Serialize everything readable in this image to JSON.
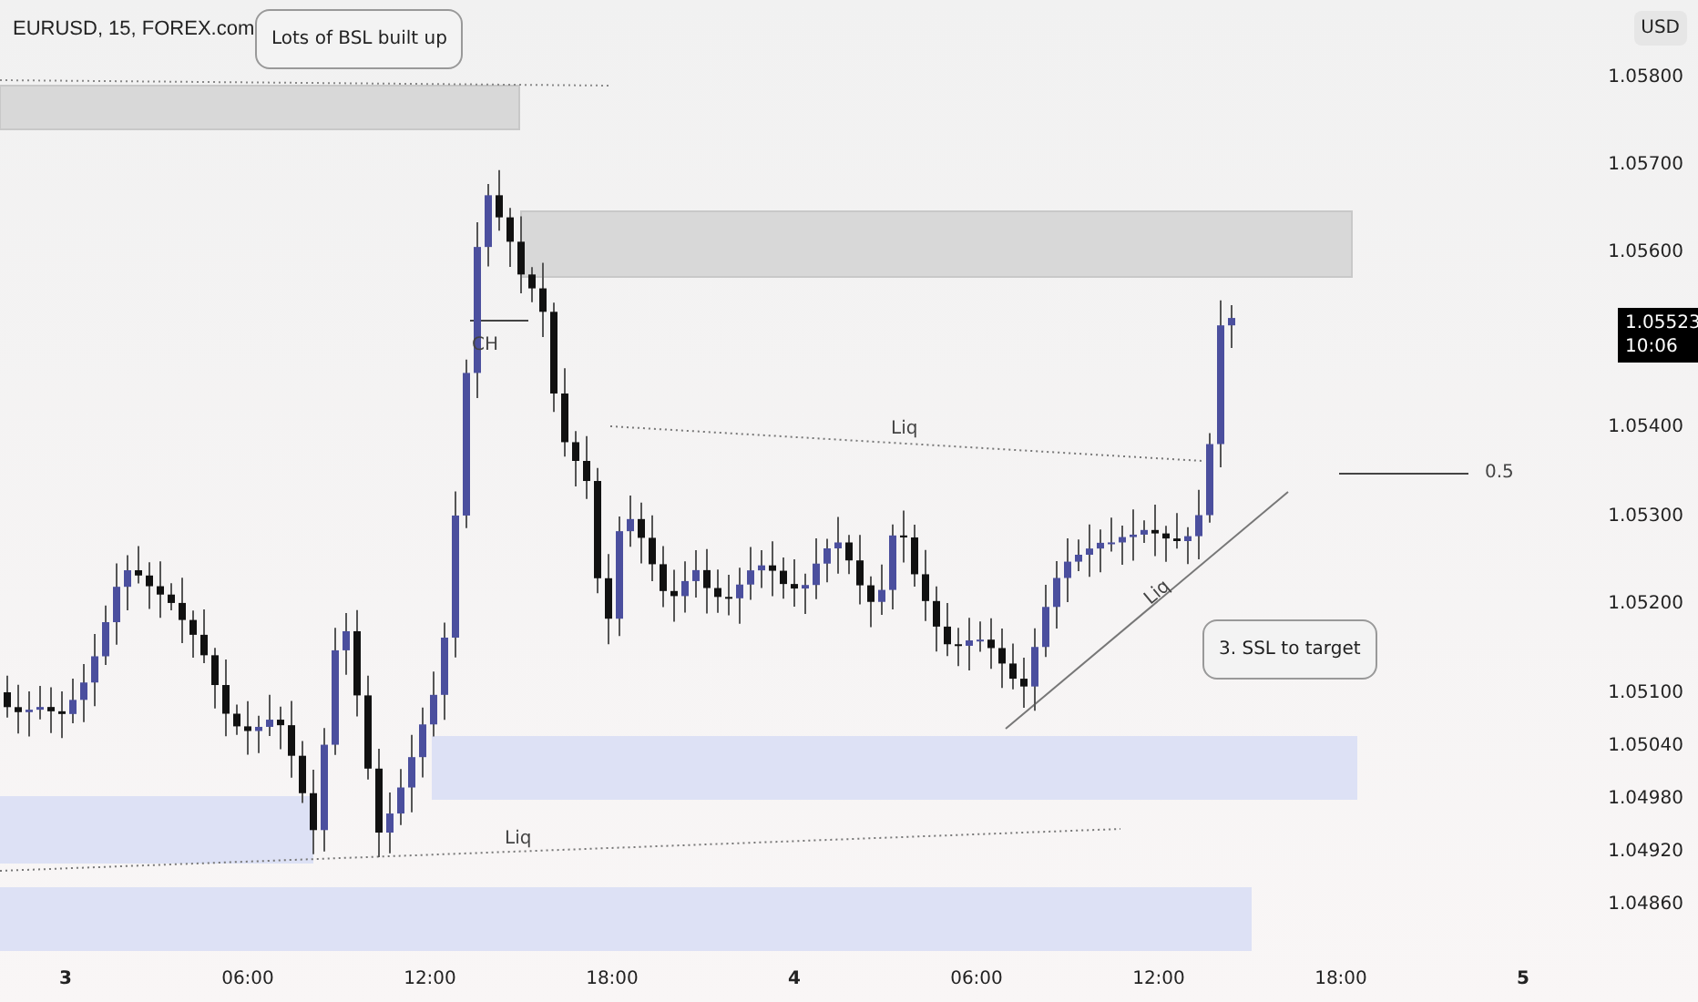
{
  "legend": {
    "title": "EURUSD, 15, FOREX.com"
  },
  "currency": "USD",
  "price_axis": [
    "1.05800",
    "1.05700",
    "1.05600",
    "1.05400",
    "1.05300",
    "1.05200",
    "1.05100",
    "1.05040",
    "1.04980",
    "1.04920",
    "1.04860"
  ],
  "last_price": {
    "price": "1.05523",
    "countdown": "10:06"
  },
  "time_axis": [
    {
      "label": "3",
      "bold": true
    },
    {
      "label": "06:00",
      "bold": false
    },
    {
      "label": "12:00",
      "bold": false
    },
    {
      "label": "18:00",
      "bold": false
    },
    {
      "label": "4",
      "bold": true
    },
    {
      "label": "06:00",
      "bold": false
    },
    {
      "label": "12:00",
      "bold": false
    },
    {
      "label": "18:00",
      "bold": false
    },
    {
      "label": "5",
      "bold": true
    }
  ],
  "annotations": [
    {
      "kind": "callout",
      "text": "Lots of BSL built up"
    },
    {
      "kind": "label",
      "text": "CH"
    },
    {
      "kind": "label",
      "text": "Liq"
    },
    {
      "kind": "label",
      "text": "Liq"
    },
    {
      "kind": "slanted",
      "text": "Liq"
    },
    {
      "kind": "callout",
      "text": "3. SSL to target"
    },
    {
      "kind": "label",
      "text": "0.5"
    }
  ]
}
